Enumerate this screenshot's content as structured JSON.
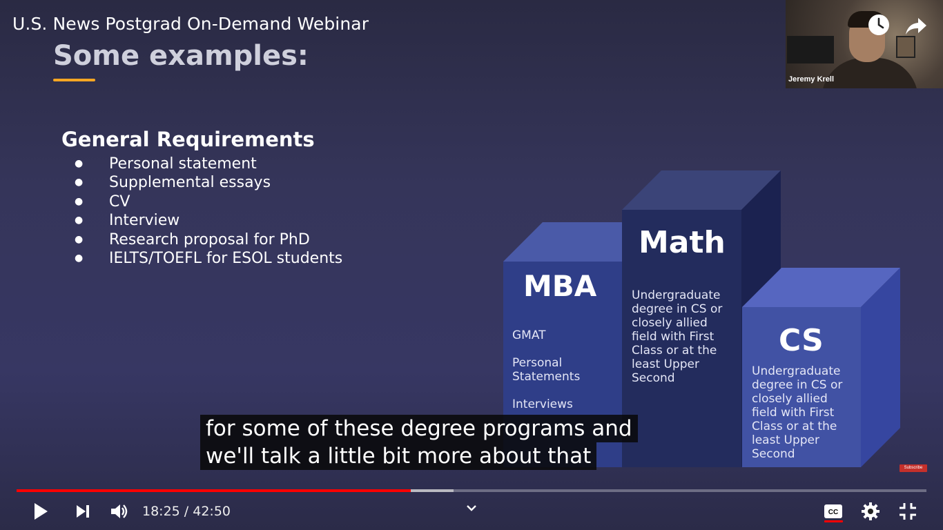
{
  "video": {
    "title": "U.S. News Postgrad On-Demand Webinar"
  },
  "webcam": {
    "name": "Jeremy Krell"
  },
  "slide": {
    "heading": "Some examples:",
    "requirements_heading": "General Requirements",
    "requirements": [
      "Personal statement",
      "Supplemental essays",
      "CV",
      "Interview",
      "Research proposal for PhD",
      "IELTS/TOEFL for ESOL students"
    ],
    "boxes": {
      "mba": {
        "title": "MBA",
        "items": [
          "GMAT",
          "Personal Statements",
          "Interviews"
        ]
      },
      "math": {
        "title": "Math",
        "text": "Undergraduate degree in CS or closely allied field with First Class or at the least Upper Second"
      },
      "cs": {
        "title": "CS",
        "text": "Undergraduate degree in CS or closely allied field with First Class or at the least Upper Second"
      }
    },
    "colors": {
      "accent": "#f5a623",
      "mba": "#2f3e88",
      "math": "#232c5d",
      "cs": "#4152a4"
    }
  },
  "captions": {
    "line1": "for some of these degree programs and",
    "line2": "we'll talk a little bit more about that"
  },
  "subscribe_badge": "Subscribe",
  "player": {
    "current_time": "18:25",
    "duration": "42:50",
    "time_text": "18:25 / 42:50",
    "progress_fraction": 0.433,
    "buffered_fraction": 0.48,
    "captions_on": true,
    "icons": [
      "play-icon",
      "next-icon",
      "volume-icon",
      "chevron-down-icon",
      "captions-icon",
      "settings-icon",
      "exit-fullscreen-icon",
      "clock-icon",
      "share-icon"
    ],
    "colors": {
      "progress": "#ff0000"
    }
  }
}
